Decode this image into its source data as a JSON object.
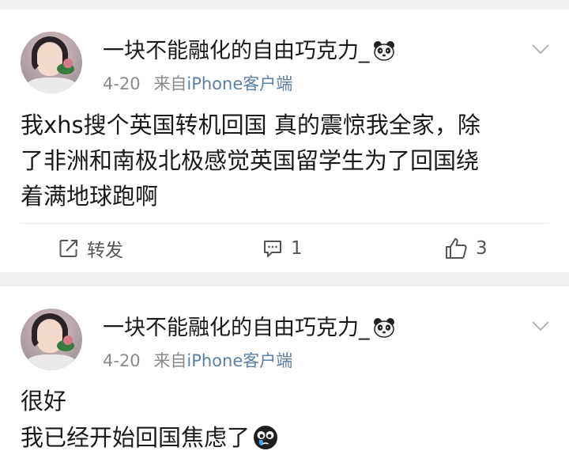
{
  "posts": [
    {
      "username": "一块不能融化的自由巧克力_",
      "date": "4-20",
      "source_prefix": "来自",
      "source": "iPhone客户端",
      "content_lines": [
        "我xhs搜个英国转机回国 真的震惊我全家，除",
        "了非洲和南极北极感觉英国留学生为了回国绕",
        "着满地球跑啊"
      ],
      "actions": {
        "repost_label": "转发",
        "comment_count": "1",
        "like_count": "3"
      }
    },
    {
      "username": "一块不能融化的自由巧克力_",
      "date": "4-20",
      "source_prefix": "来自",
      "source": "iPhone客户端",
      "content_lines": [
        "很好",
        "我已经开始回国焦虑了"
      ]
    }
  ],
  "icons": {
    "badge": "panda-icon",
    "menu": "chevron-down-icon",
    "repost": "repost-icon",
    "comment": "comment-icon",
    "like": "thumbs-up-icon",
    "emoji": "tearful-emoji-icon"
  },
  "colors": {
    "background": "#f1f1f1",
    "card": "#ffffff",
    "text": "#1a1a1a",
    "meta": "#8a8a8a",
    "source_link": "#5b7fa6"
  }
}
